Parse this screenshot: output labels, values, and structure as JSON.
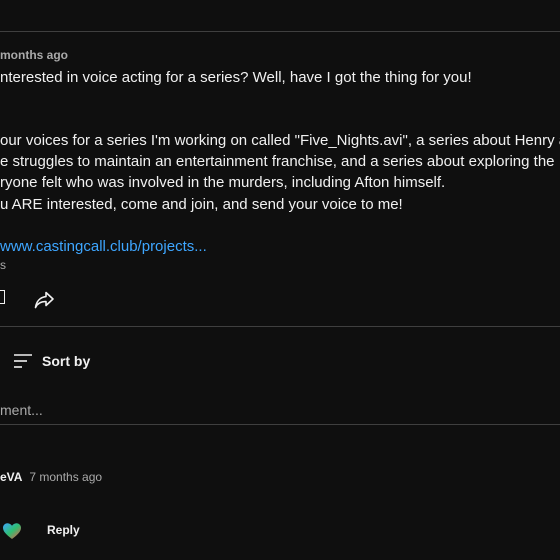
{
  "post": {
    "time_posted": "months ago",
    "lines": [
      "nterested in voice acting for a series? Well, have I got the thing for you!",
      "our voices for a series I'm working on called \"Five_Nights.avi\", a series about Henry a",
      "e struggles to maintain an entertainment franchise, and a series about exploring the",
      "ryone felt who was involved in the murders, including Afton himself.",
      "u ARE interested, come and join, and send your voice to me!"
    ],
    "link_text": "www.castingcall.club/projects...",
    "stub_text": "s"
  },
  "comments_header": {
    "sort_label": "Sort by"
  },
  "comment_box": {
    "placeholder": "ment..."
  },
  "first_comment": {
    "author": "eVA",
    "time": "7 months ago",
    "reply_label": "Reply"
  },
  "colors": {
    "background": "#0f0f0f",
    "text": "#f1f1f1",
    "muted": "#aaaaaa",
    "link": "#3ea6ff",
    "divider": "#3f3f3f"
  },
  "icons": [
    "bracket-icon",
    "share-icon",
    "sort-icon",
    "heart-icon"
  ]
}
